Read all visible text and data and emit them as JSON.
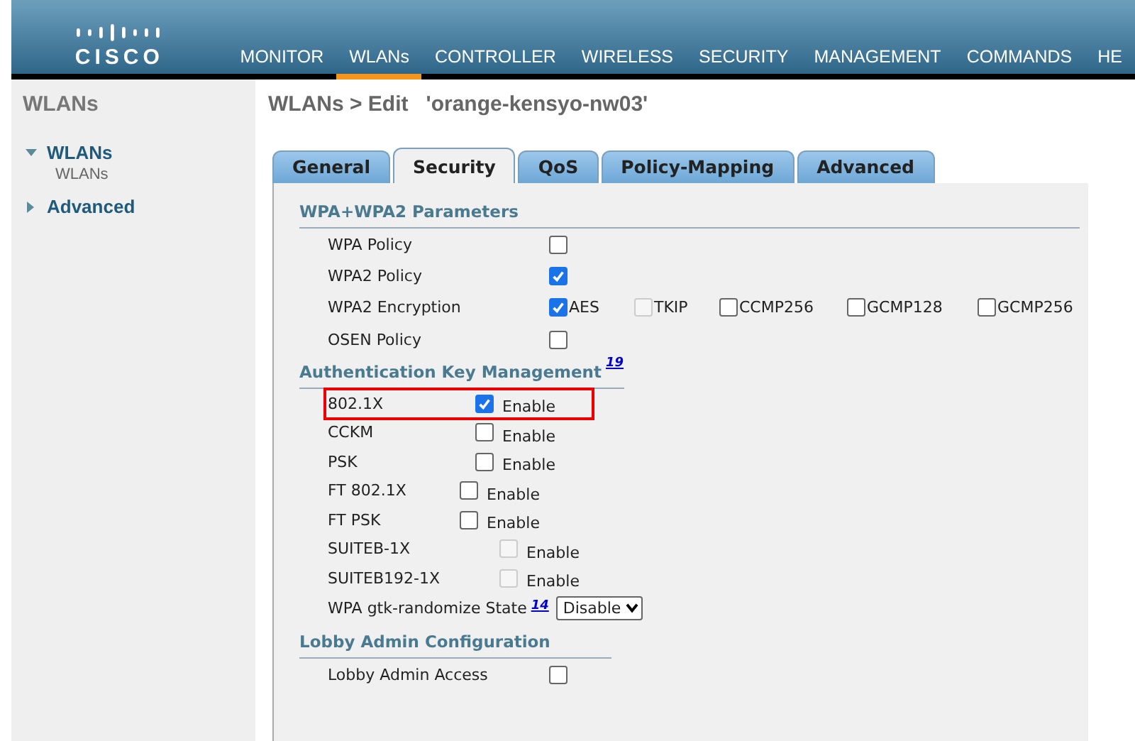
{
  "header": {
    "logo": "CISCO",
    "menu": [
      {
        "label": "MONITOR",
        "selected": false
      },
      {
        "label": "WLANs",
        "selected": true
      },
      {
        "label": "CONTROLLER",
        "selected": false
      },
      {
        "label": "WIRELESS",
        "selected": false
      },
      {
        "label": "SECURITY",
        "selected": false
      },
      {
        "label": "MANAGEMENT",
        "selected": false
      },
      {
        "label": "COMMANDS",
        "selected": false
      },
      {
        "label": "HE",
        "selected": false
      }
    ]
  },
  "sidebar": {
    "title": "WLANs",
    "items": [
      {
        "label": "WLANs",
        "expanded": true,
        "children": [
          {
            "label": "WLANs"
          }
        ]
      },
      {
        "label": "Advanced",
        "expanded": false
      }
    ]
  },
  "page_title": "WLANs > Edit   'orange-kensyo-nw03'",
  "tabs": [
    {
      "label": "General",
      "selected": false
    },
    {
      "label": "Security",
      "selected": true
    },
    {
      "label": "QoS",
      "selected": false
    },
    {
      "label": "Policy-Mapping",
      "selected": false
    },
    {
      "label": "Advanced",
      "selected": false
    }
  ],
  "sections": [
    {
      "title": "WPA+WPA2 Parameters",
      "rows": [
        {
          "kind": "checkbox",
          "label": "WPA Policy",
          "checked": false,
          "disabled": false
        },
        {
          "kind": "checkbox",
          "label": "WPA2 Policy",
          "checked": true,
          "disabled": false
        },
        {
          "kind": "options",
          "label": "WPA2 Encryption",
          "options": [
            {
              "label": "AES",
              "checked": true,
              "disabled": false
            },
            {
              "label": "TKIP",
              "checked": false,
              "disabled": true
            },
            {
              "label": "CCMP256",
              "checked": false,
              "disabled": false
            },
            {
              "label": "GCMP128",
              "checked": false,
              "disabled": false
            },
            {
              "label": "GCMP256",
              "checked": false,
              "disabled": false
            }
          ]
        },
        {
          "kind": "checkbox",
          "label": "OSEN Policy",
          "checked": false,
          "disabled": false
        }
      ]
    },
    {
      "title": "Authentication Key Management",
      "footnote": "19",
      "rows": [
        {
          "kind": "enable",
          "label": "802.1X",
          "checked": true,
          "disabled": false,
          "highlighted": true,
          "option": "Enable"
        },
        {
          "kind": "enable",
          "label": "CCKM",
          "checked": false,
          "disabled": false,
          "highlighted": false,
          "option": "Enable"
        },
        {
          "kind": "enable",
          "label": "PSK",
          "checked": false,
          "disabled": false,
          "highlighted": false,
          "option": "Enable"
        },
        {
          "kind": "enable",
          "label": "FT 802.1X",
          "checked": false,
          "disabled": false,
          "highlighted": false,
          "option": "Enable"
        },
        {
          "kind": "enable",
          "label": "FT PSK",
          "checked": false,
          "disabled": false,
          "highlighted": false,
          "option": "Enable"
        },
        {
          "kind": "enable",
          "label": "SUITEB-1X",
          "checked": false,
          "disabled": true,
          "highlighted": false,
          "option": "Enable"
        },
        {
          "kind": "enable",
          "label": "SUITEB192-1X",
          "checked": false,
          "disabled": true,
          "highlighted": false,
          "option": "Enable"
        },
        {
          "kind": "select",
          "label": "WPA gtk-randomize State",
          "footnote": "14",
          "value": "Disable"
        }
      ]
    },
    {
      "title": "Lobby Admin Configuration",
      "rows": [
        {
          "kind": "checkbox",
          "label": "Lobby Admin Access",
          "checked": false,
          "disabled": false
        }
      ]
    }
  ]
}
